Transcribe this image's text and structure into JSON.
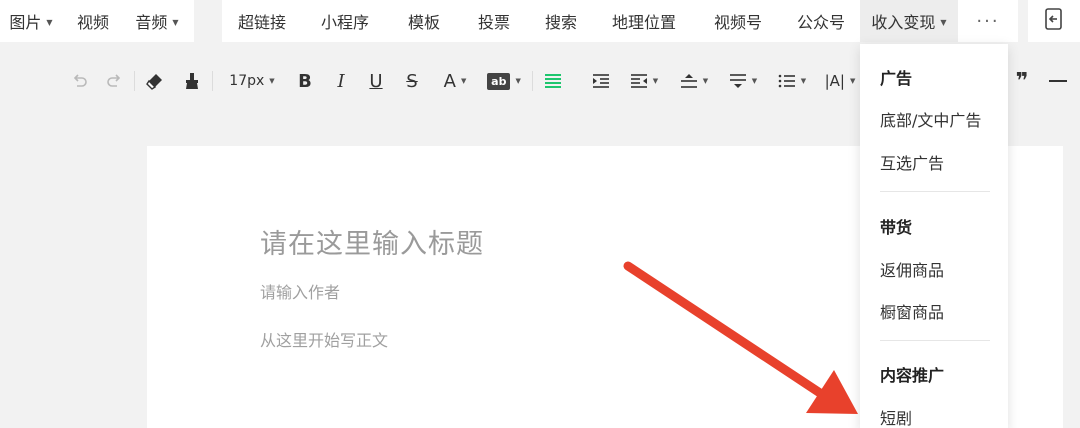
{
  "menubar": {
    "left_items": [
      {
        "label": "图片",
        "has_caret": true
      },
      {
        "label": "视频",
        "has_caret": false
      },
      {
        "label": "音频",
        "has_caret": true
      }
    ],
    "main_items": [
      {
        "label": "超链接"
      },
      {
        "label": "小程序"
      },
      {
        "label": "模板"
      },
      {
        "label": "投票"
      },
      {
        "label": "搜索"
      },
      {
        "label": "地理位置"
      },
      {
        "label": "视频号"
      },
      {
        "label": "公众号"
      },
      {
        "label": "收入变现",
        "active": true
      }
    ],
    "more_label": "···"
  },
  "toolbar": {
    "font_size": "17px",
    "icons": [
      "undo-icon",
      "redo-icon",
      "eraser-icon",
      "format-painter-icon",
      "bold-icon",
      "italic-icon",
      "underline-icon",
      "strikethrough-icon",
      "font-color-icon",
      "highlight-icon",
      "align-icon",
      "indent-icon",
      "line-height-icon",
      "paragraph-spacing-icon",
      "letter-spacing-icon",
      "list-icon",
      "text-width-icon",
      "quote-icon",
      "horizontal-rule-icon"
    ],
    "bold_glyph": "B",
    "italic_glyph": "I",
    "underline_glyph": "U",
    "strike_glyph": "S",
    "font_color_glyph": "A",
    "highlight_glyph": "ab",
    "width_glyph": "|A|",
    "quote_glyph": "❞",
    "accent_color": "#07c160"
  },
  "editor": {
    "title_placeholder": "请在这里输入标题",
    "author_placeholder": "请输入作者",
    "body_placeholder": "从这里开始写正文"
  },
  "dropdown": {
    "sections": [
      {
        "header": "广告",
        "items": [
          "底部/文中广告",
          "互选广告"
        ]
      },
      {
        "header": "带货",
        "items": [
          "返佣商品",
          "橱窗商品"
        ]
      },
      {
        "header": "内容推广",
        "items": [
          "短剧"
        ]
      }
    ]
  },
  "annotation": {
    "arrow_color": "#e8412c"
  }
}
